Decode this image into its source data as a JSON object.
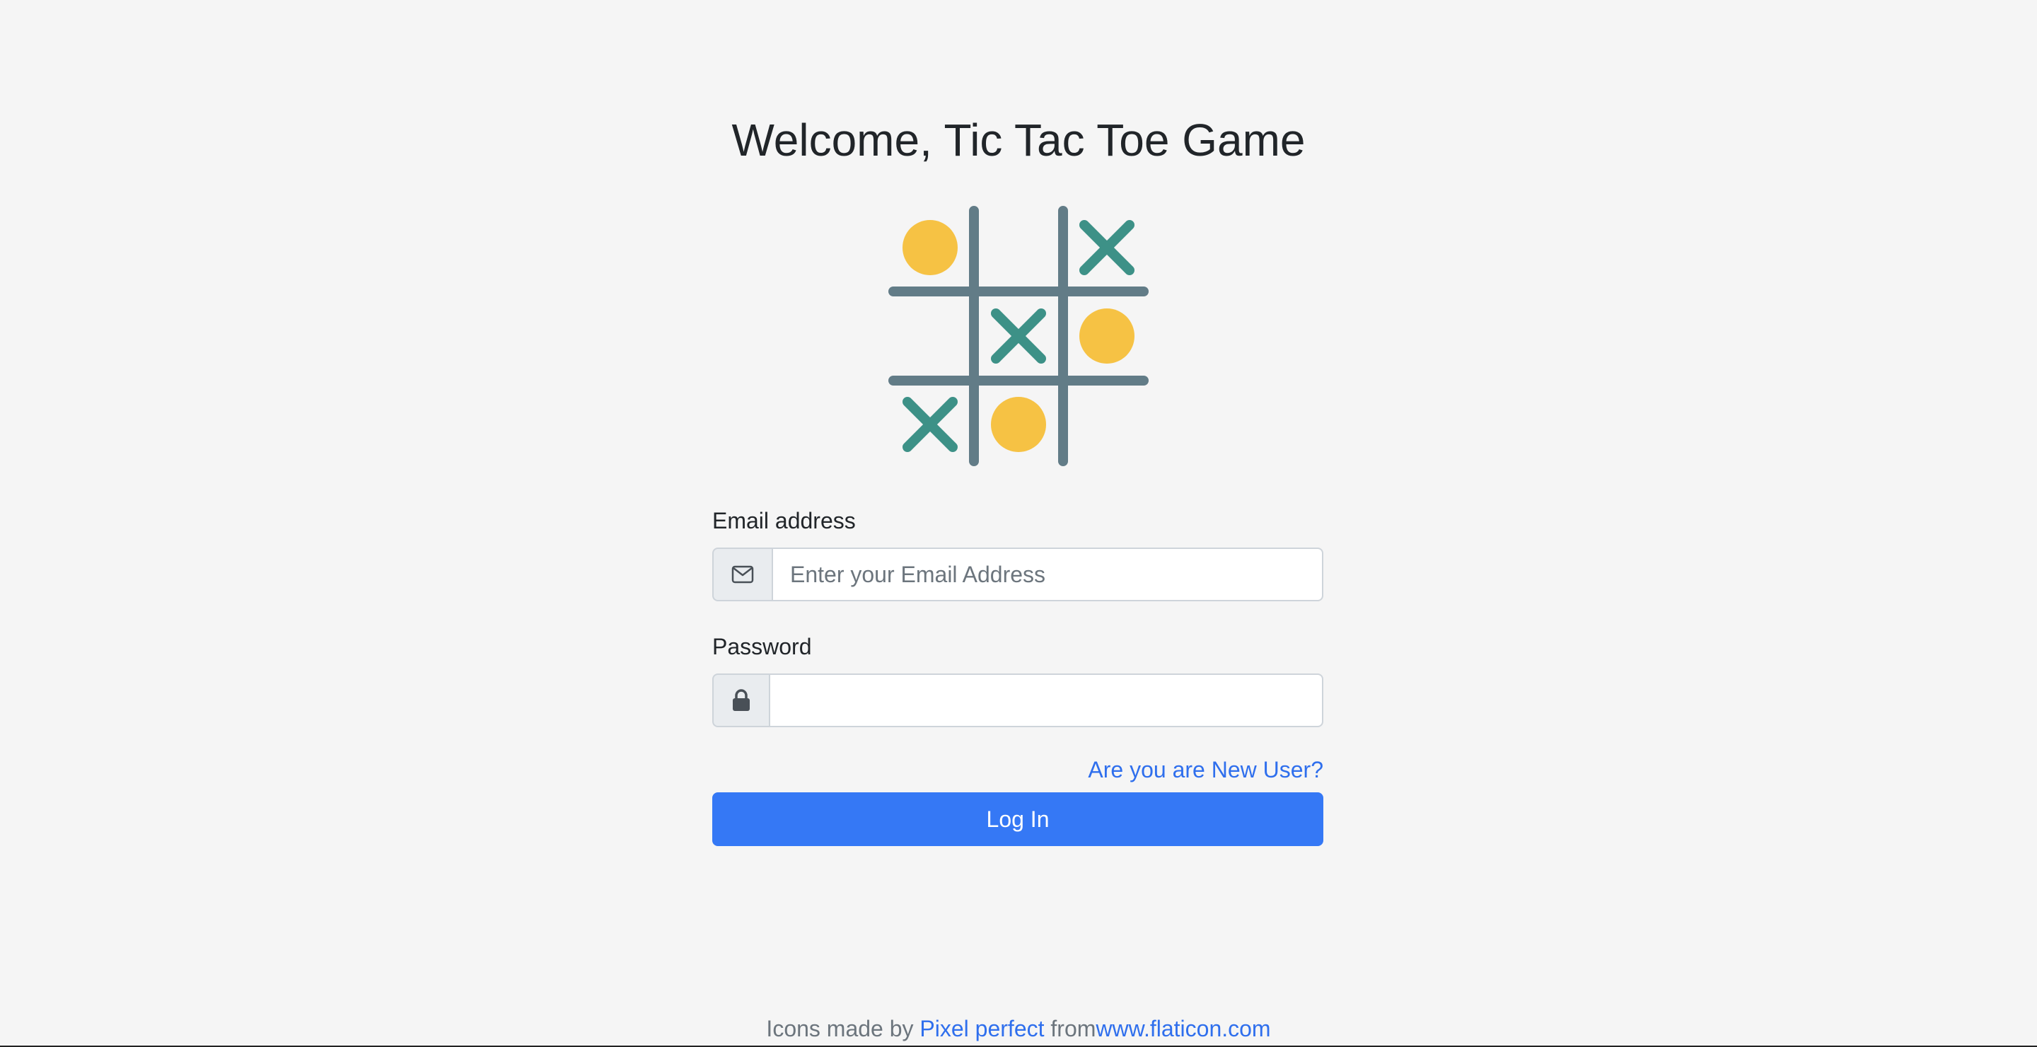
{
  "header": {
    "title": "Welcome, Tic Tac Toe Game"
  },
  "logo": {
    "icon": "tic-tac-toe-board-icon",
    "colors": {
      "grid": "#627c87",
      "circle": "#f6c244",
      "cross": "#3d9187"
    },
    "cells": [
      "O",
      "",
      "X",
      "",
      "X",
      "O",
      "X",
      "O",
      ""
    ]
  },
  "form": {
    "email": {
      "label": "Email address",
      "icon": "envelope-icon",
      "placeholder": "Enter your Email Address",
      "value": ""
    },
    "password": {
      "label": "Password",
      "icon": "lock-icon",
      "value": ""
    },
    "new_user_link": "Are you are New User?",
    "login_button": "Log In"
  },
  "footer": {
    "prefix": "Icons made by ",
    "author_link": "Pixel perfect",
    "middle": " from",
    "site_link": "www.flaticon.com"
  },
  "colors": {
    "background": "#f5f5f5",
    "primary": "#3578f5",
    "link": "#2f6fed"
  }
}
